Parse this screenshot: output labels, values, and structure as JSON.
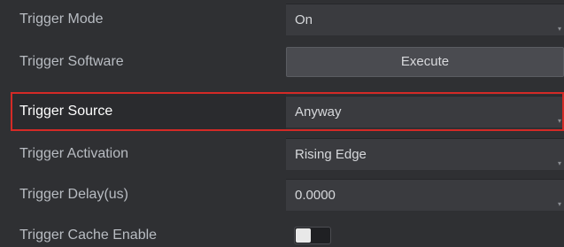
{
  "rows": [
    {
      "label": "Trigger Mode",
      "value": "On"
    },
    {
      "label": "Trigger Software",
      "button": "Execute"
    },
    {
      "label": "Trigger Source",
      "value": "Anyway"
    },
    {
      "label": "Trigger Activation",
      "value": "Rising Edge"
    },
    {
      "label": "Trigger Delay(us)",
      "value": "0.0000"
    },
    {
      "label": "Trigger Cache Enable",
      "toggle": false
    }
  ],
  "colors": {
    "background": "#2f3033",
    "field": "#3a3b3f",
    "button": "#4a4b50",
    "highlight": "#d42a26",
    "label": "#b8bcc2"
  },
  "icons": {
    "dropdown": "dropdown-corner-icon",
    "toggle": "toggle-switch-icon"
  }
}
